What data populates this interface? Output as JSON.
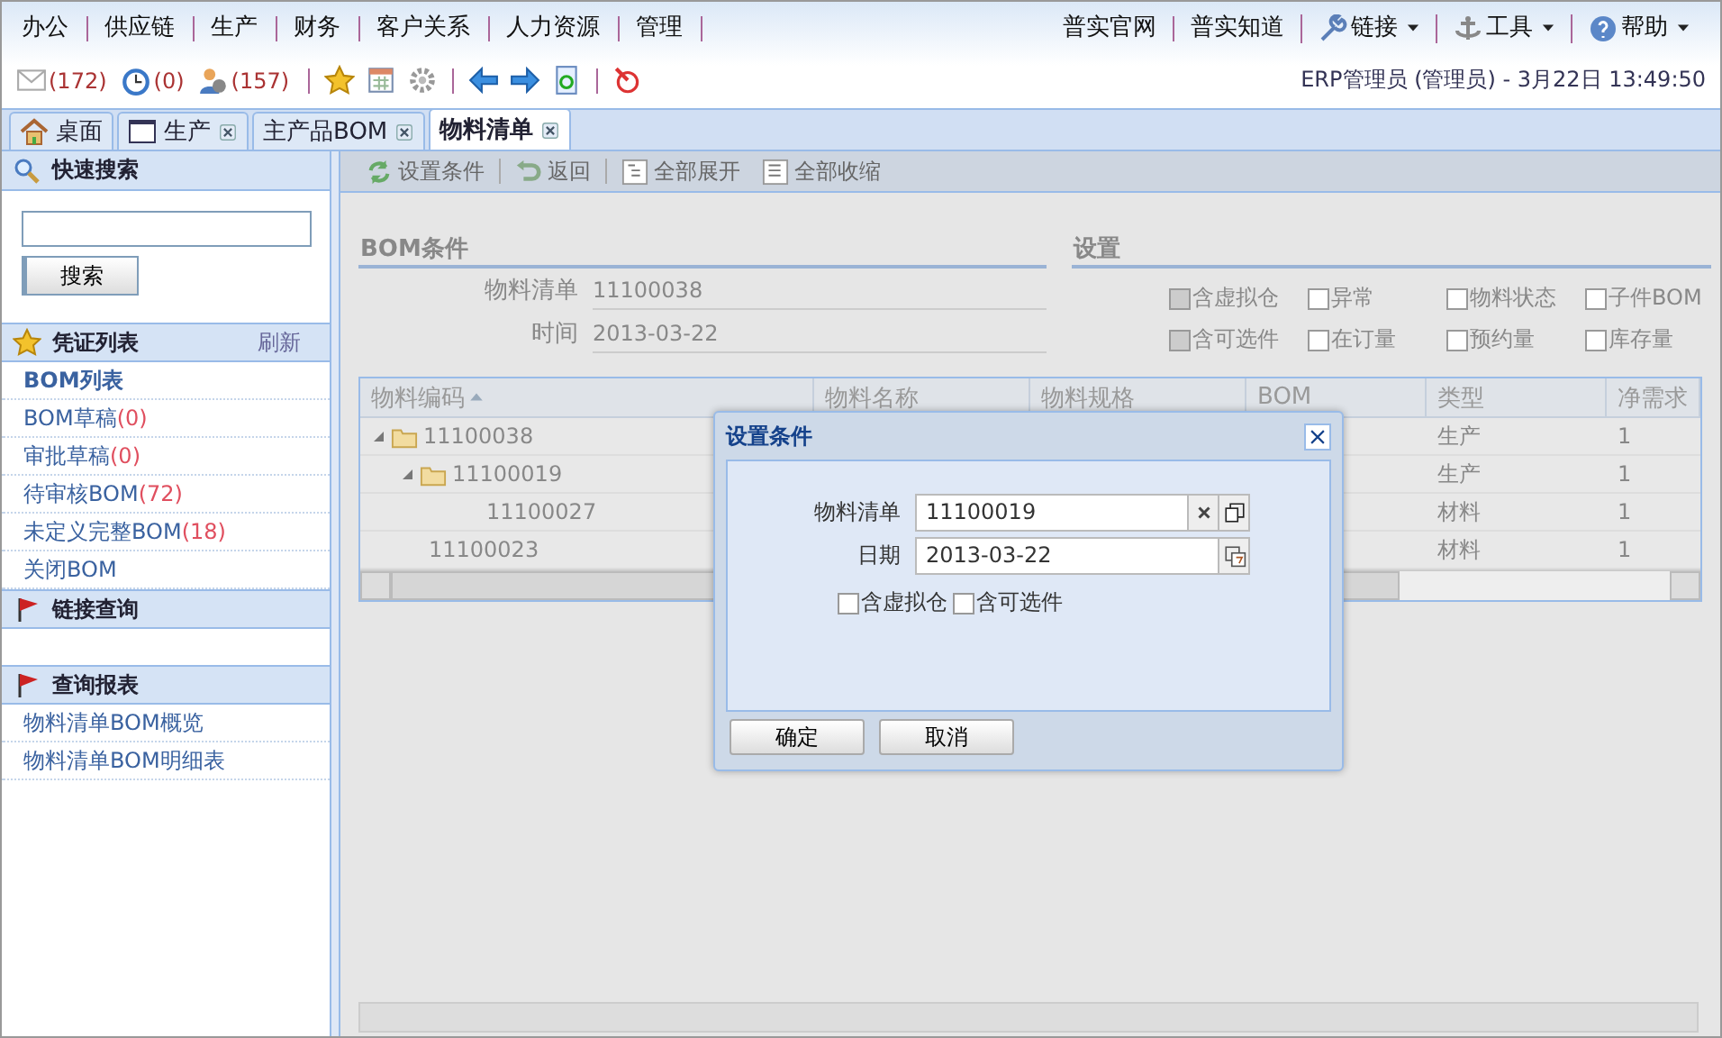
{
  "menu": [
    {
      "label": "办公"
    },
    {
      "label": "供应链"
    },
    {
      "label": "生产"
    },
    {
      "label": "财务"
    },
    {
      "label": "客户关系"
    },
    {
      "label": "人力资源"
    },
    {
      "label": "管理"
    }
  ],
  "top_links": [
    {
      "label": "普实官网",
      "dropdown": false
    },
    {
      "label": "普实知道",
      "dropdown": false
    },
    {
      "label": "链接",
      "dropdown": true
    },
    {
      "label": "工具",
      "dropdown": true
    },
    {
      "label": "帮助",
      "dropdown": true
    }
  ],
  "counters": [
    {
      "count": "(172)"
    },
    {
      "count": "(0)"
    },
    {
      "count": "(157)"
    }
  ],
  "user_info": "ERP管理员 (管理员) - 3月22日 13:49:50",
  "tabs": [
    {
      "label": "桌面",
      "selected": false,
      "closable": false
    },
    {
      "label": "生产",
      "selected": false,
      "closable": true
    },
    {
      "label": "主产品BOM",
      "selected": false,
      "closable": true
    },
    {
      "label": "物料清单",
      "selected": true,
      "closable": true
    }
  ],
  "sidebar": {
    "search": {
      "title": "快速搜索",
      "button": "搜索"
    },
    "voucher_list": {
      "title": "凭证列表",
      "action": "刷新",
      "items": [
        {
          "label": "BOM列表",
          "selected": true
        },
        {
          "label": "BOM草稿",
          "count": "(0)",
          "selected": false
        },
        {
          "label": "审批草稿",
          "count": "(0)",
          "selected": false
        },
        {
          "label": "待审核BOM",
          "count": "(72)",
          "selected": false
        },
        {
          "label": "未定义完整BOM",
          "count": "(18)",
          "selected": false
        },
        {
          "label": "关闭BOM",
          "selected": false
        }
      ]
    },
    "link_query": {
      "title": "链接查询"
    },
    "reports": {
      "title": "查询报表",
      "items": [
        {
          "label": "物料清单BOM概览"
        },
        {
          "label": "物料清单BOM明细表"
        }
      ]
    }
  },
  "toolbar": [
    {
      "label": "设置条件"
    },
    {
      "label": "返回"
    },
    {
      "label": "全部展开"
    },
    {
      "label": "全部收缩"
    }
  ],
  "bom_conditions": {
    "title": "BOM条件",
    "fields": [
      {
        "label": "物料清单",
        "value": "11100038"
      },
      {
        "label": "时间",
        "value": "2013-03-22"
      }
    ]
  },
  "settings": {
    "title": "设置",
    "options": [
      {
        "label": "含虚拟仓",
        "checked": false,
        "disabled": true
      },
      {
        "label": "异常",
        "checked": false,
        "disabled": false
      },
      {
        "label": "物料状态",
        "checked": false,
        "disabled": false
      },
      {
        "label": "子件BOM",
        "checked": false,
        "disabled": false
      },
      {
        "label": "含可选件",
        "checked": false,
        "disabled": true
      },
      {
        "label": "在订量",
        "checked": false,
        "disabled": false
      },
      {
        "label": "预约量",
        "checked": false,
        "disabled": false
      },
      {
        "label": "库存量",
        "checked": false,
        "disabled": false
      }
    ]
  },
  "table": {
    "columns": [
      "物料编码",
      "物料名称",
      "物料规格",
      "BOM",
      "类型",
      "净需求"
    ],
    "rows": [
      {
        "code": "11100038",
        "type": "生产",
        "qty": "1",
        "expanded": true,
        "children": [
          {
            "code": "11100019",
            "type": "生产",
            "qty": "1",
            "expanded": true,
            "children": [
              {
                "code": "11100027",
                "type": "材料",
                "qty": "1"
              }
            ]
          }
        ]
      },
      {
        "code": "11100023",
        "type": "材料",
        "qty": "1"
      }
    ]
  },
  "dialog": {
    "title": "设置条件",
    "fields": [
      {
        "label": "物料清单",
        "value": "11100019",
        "kind": "lookup"
      },
      {
        "label": "日期",
        "value": "2013-03-22",
        "kind": "date"
      }
    ],
    "options": [
      {
        "label": "含虚拟仓",
        "checked": false
      },
      {
        "label": "含可选件",
        "checked": false
      }
    ],
    "buttons": [
      "确定",
      "取消"
    ]
  }
}
